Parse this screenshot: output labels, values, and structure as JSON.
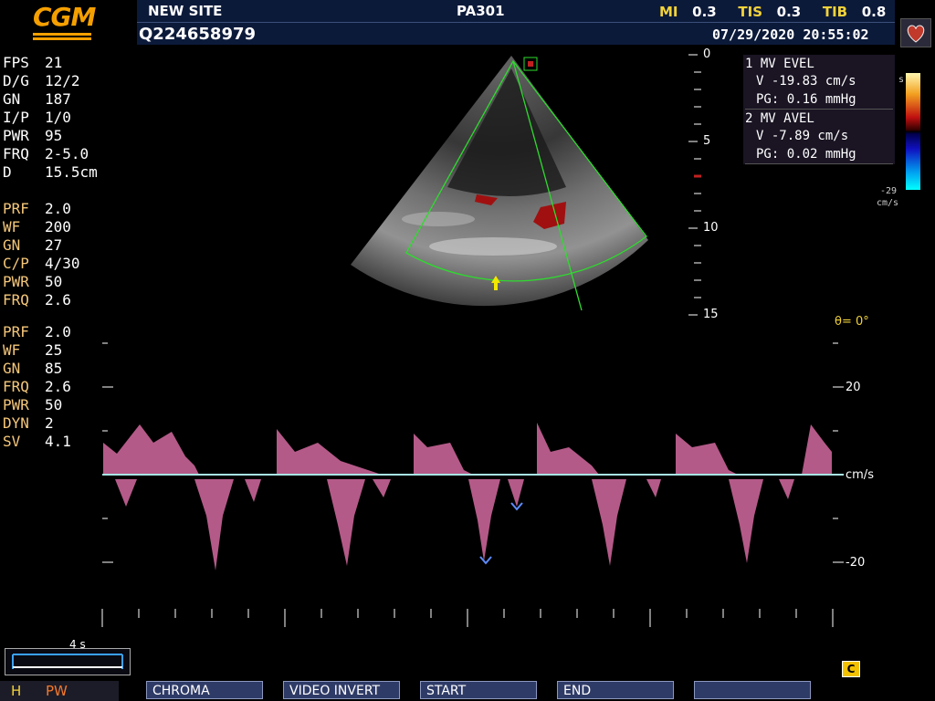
{
  "header": {
    "logo_text": "CGM",
    "site": "NEW SITE",
    "probe": "PA301",
    "patient_id": "Q224658979",
    "datetime": "07/29/2020 20:55:02",
    "mi_label": "MI",
    "mi_value": "0.3",
    "tis_label": "TIS",
    "tis_value": "0.3",
    "tib_label": "TIB",
    "tib_value": "0.8"
  },
  "params_2d": [
    {
      "label": "FPS",
      "value": "21"
    },
    {
      "label": "D/G",
      "value": "12/2"
    },
    {
      "label": "GN",
      "value": "187"
    },
    {
      "label": "I/P",
      "value": "1/0"
    },
    {
      "label": "PWR",
      "value": "95"
    },
    {
      "label": "FRQ",
      "value": "2-5.0"
    },
    {
      "label": "D",
      "value": "15.5cm"
    }
  ],
  "params_color": [
    {
      "label": "PRF",
      "value": "2.0"
    },
    {
      "label": "WF",
      "value": "200"
    },
    {
      "label": "GN",
      "value": "27"
    },
    {
      "label": "C/P",
      "value": "4/30"
    },
    {
      "label": "PWR",
      "value": "50"
    },
    {
      "label": "FRQ",
      "value": "2.6"
    }
  ],
  "params_pw": [
    {
      "label": "PRF",
      "value": "2.0"
    },
    {
      "label": "WF",
      "value": "25"
    },
    {
      "label": "GN",
      "value": "85"
    },
    {
      "label": "FRQ",
      "value": "2.6"
    },
    {
      "label": "PWR",
      "value": "50"
    },
    {
      "label": "DYN",
      "value": "2"
    },
    {
      "label": "SV",
      "value": "4.1"
    }
  ],
  "measurements": {
    "m1_title": "1 MV EVEL",
    "m1_v": "V -19.83 cm/s",
    "m1_pg": "PG: 0.16 mmHg",
    "m2_title": "2 MV AVEL",
    "m2_v": "V -7.89 cm/s",
    "m2_pg": "PG: 0.02 mmHg"
  },
  "color_bar": {
    "bottom_value": "-29",
    "bottom_unit": "cm/s",
    "top_unit": "s"
  },
  "depth_scale": [
    "0",
    "5",
    "10",
    "15"
  ],
  "doppler": {
    "angle": "θ= 0°",
    "upper_label": "20",
    "lower_label": "-20",
    "unit": "cm/s",
    "time_scale": "4 s"
  },
  "mode": {
    "h": "H",
    "pw": "PW",
    "c_icon": "C"
  },
  "softkeys": [
    "CHROMA",
    "VIDEO INVERT",
    "START",
    "END",
    ""
  ]
}
